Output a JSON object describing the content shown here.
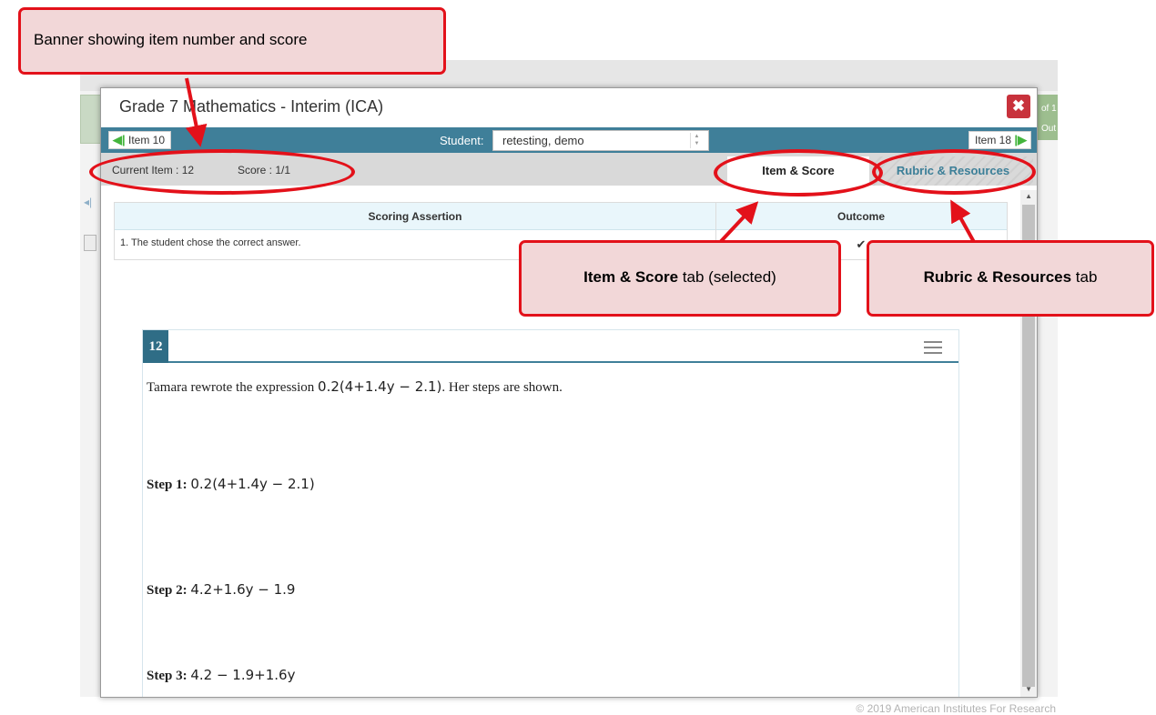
{
  "background_page": {
    "copyright": "© 2019 American Institutes For Research",
    "right_text_1": "of 1",
    "right_text_2": "Out"
  },
  "modal": {
    "title": "Grade 7 Mathematics - Interim (ICA)",
    "close_glyph": "✖",
    "nav": {
      "prev_label": "Item 10",
      "prev_icon": "double-left-arrow-icon",
      "next_label": "Item 18",
      "next_icon": "double-right-arrow-icon",
      "student_label": "Student:",
      "student_value": "retesting, demo"
    },
    "status": {
      "current_item": "Current Item : 12",
      "score": "Score : 1/1"
    },
    "tabs": [
      {
        "label": "Item & Score",
        "selected": true
      },
      {
        "label": "Rubric & Resources",
        "selected": false
      }
    ],
    "scoring_table": {
      "headers": [
        "Scoring Assertion",
        "Outcome"
      ],
      "rows": [
        {
          "assertion": "1. The student chose the correct answer.",
          "outcome": "✔"
        }
      ]
    },
    "item": {
      "number": "12",
      "question_prefix": "Tamara rewrote the expression ",
      "question_expr": "0.2(4+1.4y − 2.1)",
      "question_suffix": ". Her steps are shown.",
      "steps": [
        {
          "label": "Step 1:",
          "expr": "0.2(4+1.4y − 2.1)"
        },
        {
          "label": "Step 2:",
          "expr": "4.2+1.6y − 1.9"
        },
        {
          "label": "Step 3:",
          "expr": "4.2 − 1.9+1.6y"
        }
      ]
    }
  },
  "callouts": {
    "banner": "Banner showing item number and score",
    "item_score_bold": "Item & Score",
    "item_score_rest": " tab (selected)",
    "rubric_bold": "Rubric & Resources",
    "rubric_rest": " tab"
  },
  "colors": {
    "nav_bar": "#3f7f99",
    "close_button": "#c8323c",
    "callout_border": "#e3111a",
    "callout_fill": "#f2d7d8",
    "nav_arrow": "#44b53d"
  }
}
